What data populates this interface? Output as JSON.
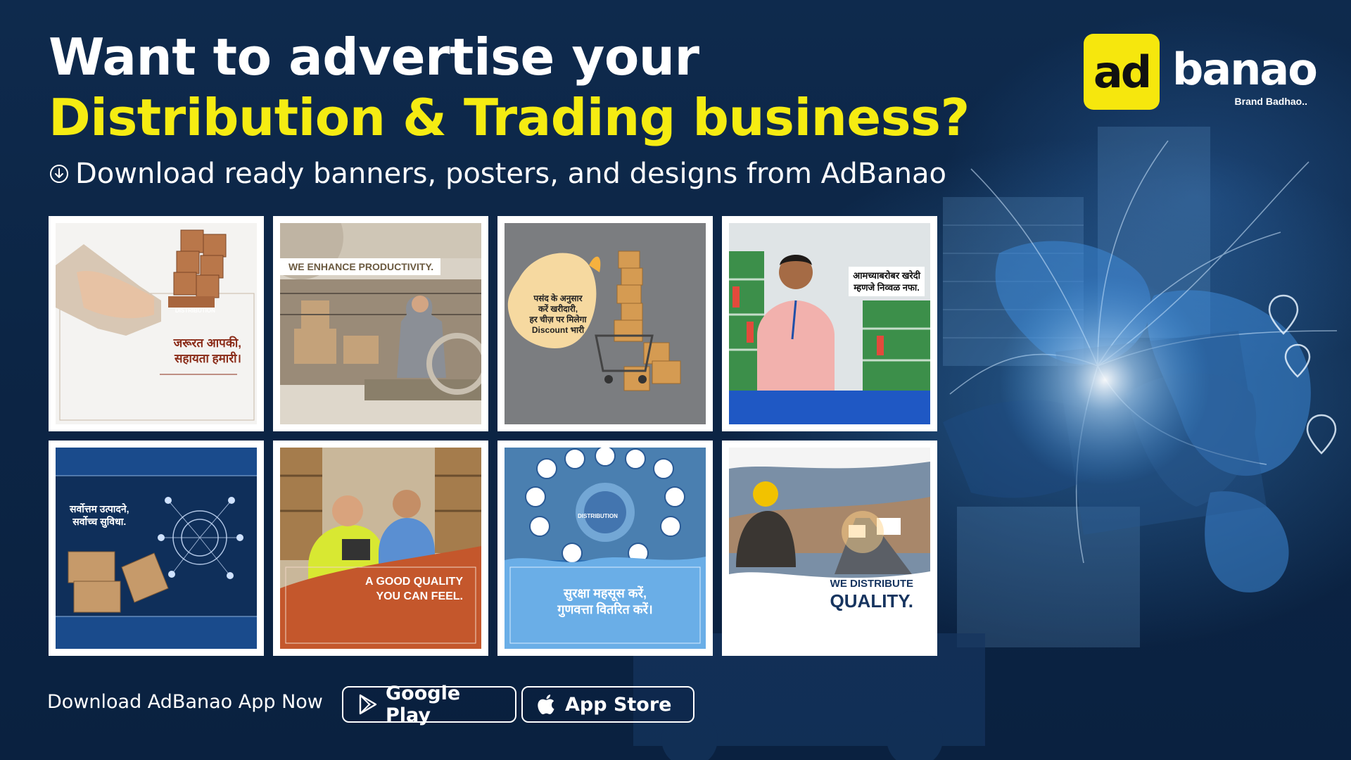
{
  "headline": {
    "line1": "Want to advertise your",
    "line2": "Distribution & Trading business?"
  },
  "subline": {
    "icon": "download-circle-icon",
    "text": "Download ready banners, posters, and designs from AdBanao"
  },
  "logo": {
    "badge_text": "ad",
    "word": "banao",
    "tagline": "Brand Badhao.."
  },
  "colors": {
    "accent_yellow": "#f5ec12",
    "background_navy": "#0c2444"
  },
  "cards": [
    {
      "lines": [
        "जरूरत आपकी,",
        "सहायता हमारी।"
      ],
      "tag": "DISTRIBUTION"
    },
    {
      "lines": [
        "WE ENHANCE PRODUCTIVITY."
      ]
    },
    {
      "lines": [
        "पसंद के अनुसार",
        "करें खरीदारी,",
        "हर चीज़ पर मिलेगा",
        "Discount भारी"
      ]
    },
    {
      "lines": [
        "आमच्याबरोबर खरेदी",
        "म्हणजे निव्वळ नफा."
      ]
    },
    {
      "lines": [
        "सर्वोत्तम उत्पादने,",
        "सर्वोच्च सुविधा."
      ]
    },
    {
      "lines": [
        "A GOOD QUALITY",
        "YOU CAN FEEL."
      ]
    },
    {
      "lines": [
        "सुरक्षा महसूस करें,",
        "गुणवत्ता वितरित करें।"
      ],
      "tag": "DISTRIBUTION"
    },
    {
      "lines": [
        "WE DISTRIBUTE",
        "QUALITY."
      ]
    }
  ],
  "footer": {
    "download_text": "Download AdBanao App Now",
    "google_play": {
      "label": "Google Play",
      "icon": "google-play-icon"
    },
    "app_store": {
      "label": "App Store",
      "icon": "apple-icon"
    }
  }
}
